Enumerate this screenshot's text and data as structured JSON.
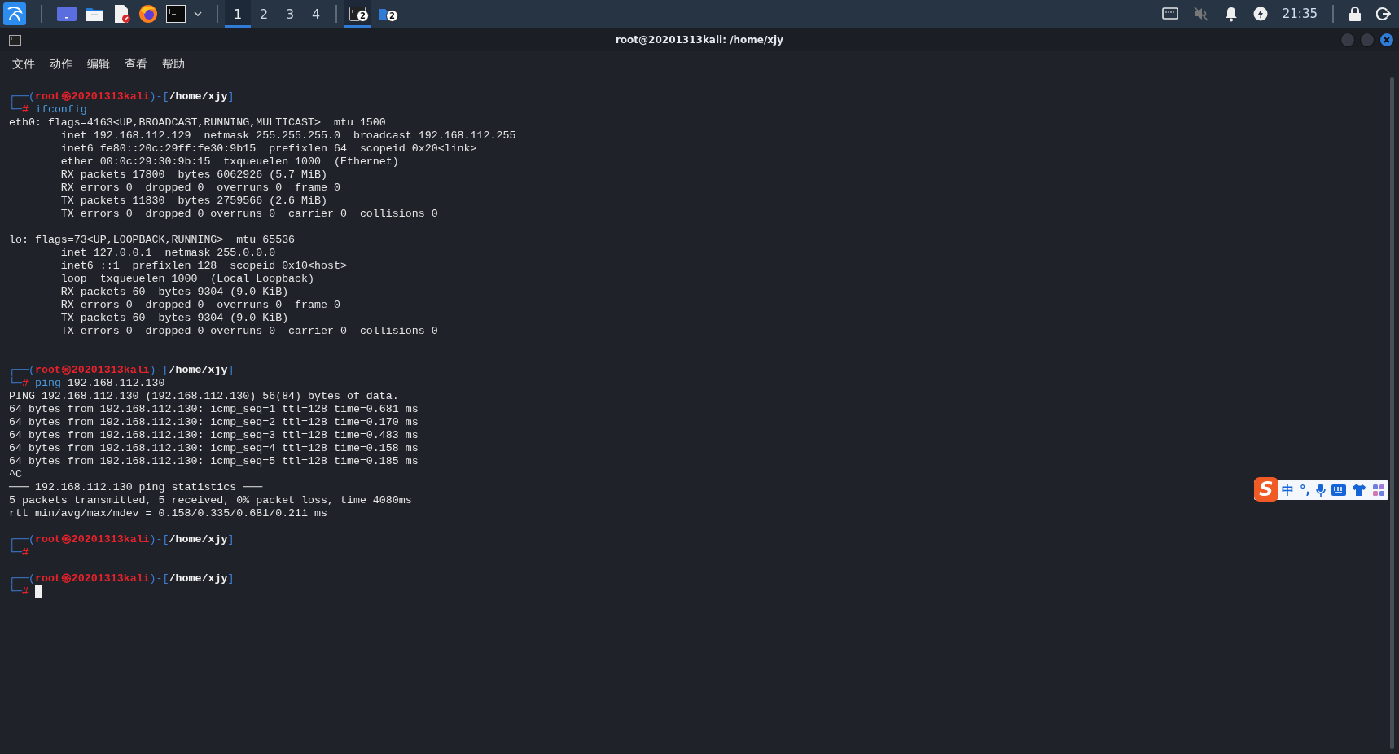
{
  "taskbar": {
    "workspaces": [
      {
        "label": "1",
        "selected": true
      },
      {
        "label": "2",
        "selected": false
      },
      {
        "label": "3",
        "selected": false
      },
      {
        "label": "4",
        "selected": false
      }
    ],
    "tasks": [
      {
        "kind": "terminal",
        "badge": "2",
        "selected": true
      },
      {
        "kind": "folder",
        "badge": "2",
        "selected": false
      }
    ],
    "clock": "21:35"
  },
  "window": {
    "title": "root@20201313kali: /home/xjy",
    "menu": [
      "文件",
      "动作",
      "编辑",
      "查看",
      "帮助"
    ]
  },
  "terminal": {
    "blocks": [
      {
        "kind": "prompt",
        "open": "┌──(",
        "user": "root",
        "at": "㉿",
        "host": "20201313kali",
        "mid": ")-[",
        "path": "/home/xjy",
        "close": "]",
        "corner": "└─",
        "sign": "#",
        "command": "ifconfig",
        "cursor": false
      },
      {
        "kind": "output",
        "lines": [
          "eth0: flags=4163<UP,BROADCAST,RUNNING,MULTICAST>  mtu 1500",
          "        inet 192.168.112.129  netmask 255.255.255.0  broadcast 192.168.112.255",
          "        inet6 fe80::20c:29ff:fe30:9b15  prefixlen 64  scopeid 0x20<link>",
          "        ether 00:0c:29:30:9b:15  txqueuelen 1000  (Ethernet)",
          "        RX packets 17800  bytes 6062926 (5.7 MiB)",
          "        RX errors 0  dropped 0  overruns 0  frame 0",
          "        TX packets 11830  bytes 2759566 (2.6 MiB)",
          "        TX errors 0  dropped 0 overruns 0  carrier 0  collisions 0"
        ]
      },
      {
        "kind": "gap"
      },
      {
        "kind": "output",
        "lines": [
          "lo: flags=73<UP,LOOPBACK,RUNNING>  mtu 65536",
          "        inet 127.0.0.1  netmask 255.0.0.0",
          "        inet6 ::1  prefixlen 128  scopeid 0x10<host>",
          "        loop  txqueuelen 1000  (Local Loopback)",
          "        RX packets 60  bytes 9304 (9.0 KiB)",
          "        RX errors 0  dropped 0  overruns 0  frame 0",
          "        TX packets 60  bytes 9304 (9.0 KiB)",
          "        TX errors 0  dropped 0 overruns 0  carrier 0  collisions 0"
        ]
      },
      {
        "kind": "gap"
      },
      {
        "kind": "gap"
      },
      {
        "kind": "prompt",
        "open": "┌──(",
        "user": "root",
        "at": "㉿",
        "host": "20201313kali",
        "mid": ")-[",
        "path": "/home/xjy",
        "close": "]",
        "corner": "└─",
        "sign": "#",
        "command": "ping",
        "args": "192.168.112.130",
        "cursor": false
      },
      {
        "kind": "output",
        "lines": [
          "PING 192.168.112.130 (192.168.112.130) 56(84) bytes of data.",
          "64 bytes from 192.168.112.130: icmp_seq=1 ttl=128 time=0.681 ms",
          "64 bytes from 192.168.112.130: icmp_seq=2 ttl=128 time=0.170 ms",
          "64 bytes from 192.168.112.130: icmp_seq=3 ttl=128 time=0.483 ms",
          "64 bytes from 192.168.112.130: icmp_seq=4 ttl=128 time=0.158 ms",
          "64 bytes from 192.168.112.130: icmp_seq=5 ttl=128 time=0.185 ms",
          "^C",
          "─── 192.168.112.130 ping statistics ───",
          "5 packets transmitted, 5 received, 0% packet loss, time 4080ms",
          "rtt min/avg/max/mdev = 0.158/0.335/0.681/0.211 ms"
        ]
      },
      {
        "kind": "gap"
      },
      {
        "kind": "prompt",
        "open": "┌──(",
        "user": "root",
        "at": "㉿",
        "host": "20201313kali",
        "mid": ")-[",
        "path": "/home/xjy",
        "close": "]",
        "corner": "└─",
        "sign": "#",
        "cursor": false
      },
      {
        "kind": "gap"
      },
      {
        "kind": "prompt",
        "open": "┌──(",
        "user": "root",
        "at": "㉿",
        "host": "20201313kali",
        "mid": ")-[",
        "path": "/home/xjy",
        "close": "]",
        "corner": "└─",
        "sign": "#",
        "cursor": true
      }
    ]
  },
  "ime": {
    "logo": "S",
    "mode": "中",
    "punctuation": "°,"
  }
}
